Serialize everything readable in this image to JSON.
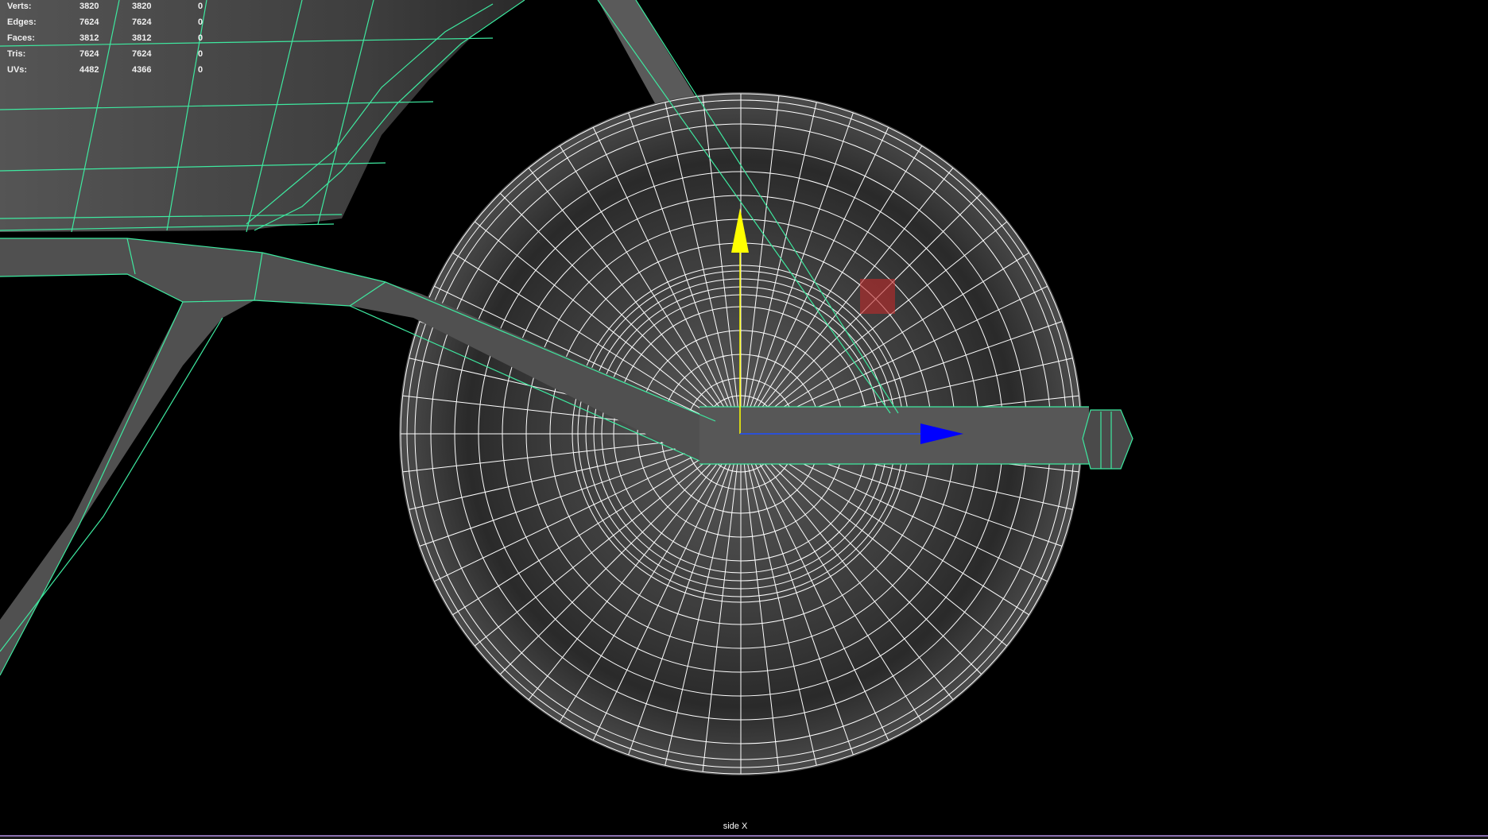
{
  "hud": {
    "rows": [
      {
        "label": "Verts:",
        "v1": "3820",
        "v2": "3820",
        "v3": "0"
      },
      {
        "label": "Edges:",
        "v1": "7624",
        "v2": "7624",
        "v3": "0"
      },
      {
        "label": "Faces:",
        "v1": "3812",
        "v2": "3812",
        "v3": "0"
      },
      {
        "label": "Tris:",
        "v1": "7624",
        "v2": "7624",
        "v3": "0"
      },
      {
        "label": "UVs:",
        "v1": "4482",
        "v2": "4366",
        "v3": "0"
      }
    ]
  },
  "viewport": {
    "camera_label": "side X"
  },
  "colors": {
    "background": "#000000",
    "wire_selected": "#3ee9a0",
    "wire_white": "#ffffff",
    "mesh_fill": "#4a4a4a",
    "manip_y": "#ffff00",
    "manip_z": "#0000ff",
    "manip_center": "#ff3333"
  },
  "icons": {
    "move_manip_y": "yellow-cone-arrow",
    "move_manip_z": "blue-cone-arrow",
    "move_manip_plane": "red-square-handle"
  }
}
